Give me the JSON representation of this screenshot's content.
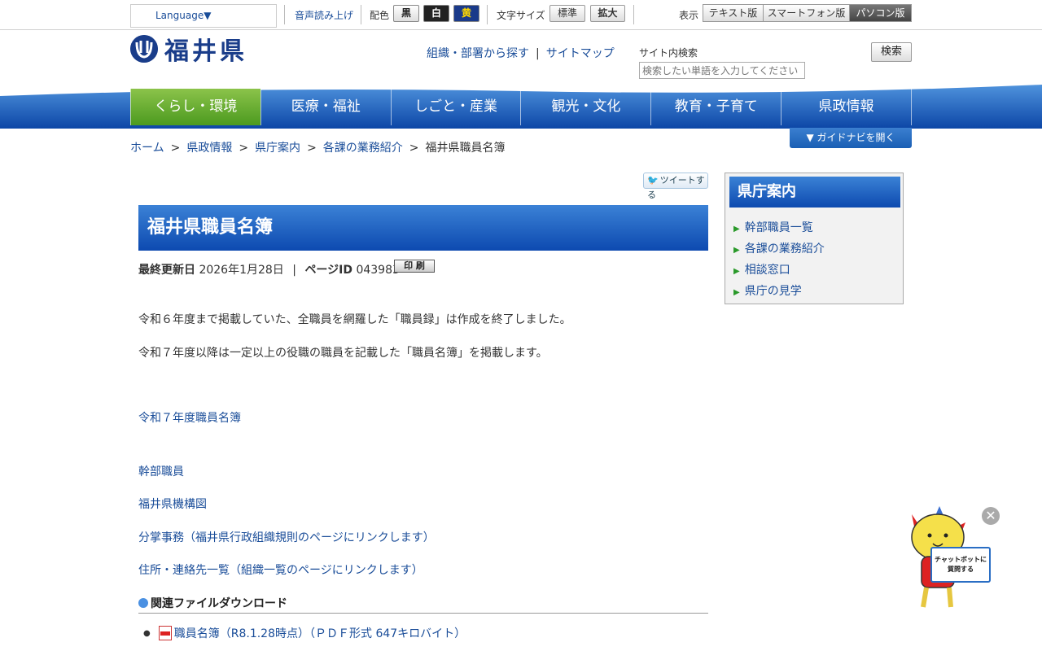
{
  "topbar": {
    "language_label": "Language▼",
    "voice_label": "音声読み上げ",
    "color_label": "配色",
    "color_buttons": [
      "黒",
      "白",
      "黄"
    ],
    "font_size_label": "文字サイズ",
    "font_size_buttons": [
      "標準",
      "拡大"
    ],
    "display_label": "表示",
    "display_buttons": [
      "テキスト版",
      "スマートフォン版",
      "パソコン版"
    ]
  },
  "header": {
    "logo_text": "福井県",
    "link_org": "組織・部署から探す",
    "link_separator": "|",
    "link_sitemap": "サイトマップ",
    "search_label": "サイト内検索",
    "search_placeholder": "検索したい単語を入力してください",
    "search_button": "検索"
  },
  "nav": {
    "items": [
      "くらし・環境",
      "医療・福祉",
      "しごと・産業",
      "観光・文化",
      "教育・子育て",
      "県政情報"
    ],
    "active_index": 0
  },
  "breadcrumb": {
    "items": [
      "ホーム",
      "県政情報",
      "県庁案内",
      "各課の業務紹介",
      "福井県職員名簿"
    ],
    "separator": ">"
  },
  "guide_button": "▼ ガイドナビを開く",
  "tweet_button": "ツイートする",
  "page": {
    "title": "福井県職員名簿",
    "updated_label": "最終更新日",
    "updated_date": "2026年1月28日",
    "meta_separator": "|",
    "page_id_label": "ページID",
    "page_id": "043983",
    "print_button": "印 刷",
    "paragraph1": "令和６年度まで掲載していた、全職員を網羅した「職員録」は作成を終了しました。",
    "paragraph2": "令和７年度以降は一定以上の役職の職員を記載した「職員名簿」を掲載します。",
    "link_meibo": "令和７年度職員名簿",
    "link_kanbu": "幹部職員",
    "link_kikou": "福井県機構図",
    "link_bunsho": "分掌事務（福井県行政組織規則のページにリンクします）",
    "link_jusho": "住所・連絡先一覧（組織一覧のページにリンクします）",
    "download_heading": "関連ファイルダウンロード",
    "download_item": "職員名簿（R8.1.28時点）（ＰＤＦ形式 647キロバイト）"
  },
  "side": {
    "title": "県庁案内",
    "items": [
      "幹部職員一覧",
      "各課の業務紹介",
      "相談窓口",
      "県庁の見学"
    ]
  },
  "chatbot": {
    "sign_line1": "チャットボットに",
    "sign_line2": "質問する",
    "close": "✕"
  },
  "colors": {
    "nav_blue": "#0d4ab0",
    "nav_active_green": "#4c9a1f",
    "link_blue": "#1a4d99"
  }
}
